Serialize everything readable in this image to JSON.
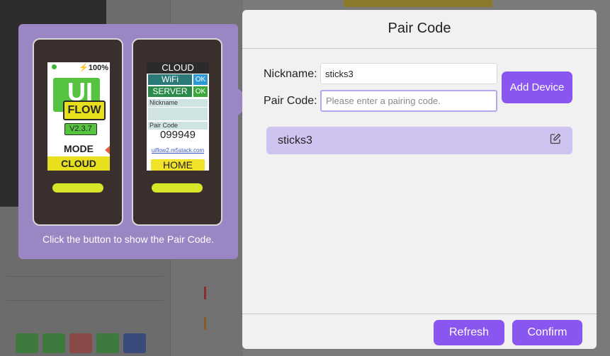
{
  "dialog": {
    "title": "Pair Code",
    "nickname_label": "Nickname:",
    "nickname_value": "sticks3",
    "paircode_label": "Pair Code:",
    "paircode_placeholder": "Please enter a pairing code.",
    "add_device_label": "Add Device",
    "devices": [
      {
        "name": "sticks3"
      }
    ],
    "refresh_label": "Refresh",
    "confirm_label": "Confirm",
    "accent_color": "#8a56f0"
  },
  "info": {
    "caption": "Click the button to show the Pair Code.",
    "device1": {
      "battery": "100%",
      "logo": "UI",
      "flow": "FLOW",
      "version": "V2.3.7",
      "mode": "MODE",
      "cloud": "CLOUD"
    },
    "device2": {
      "header": "CLOUD",
      "wifi": "WiFi",
      "wifi_status": "OK",
      "server": "SERVER",
      "server_status": "OK",
      "nickname_label": "Nickname",
      "paircode_label": "Pair Code",
      "paircode": "099949",
      "url": "uiflow2.m5stack.com",
      "home": "HOME"
    }
  }
}
